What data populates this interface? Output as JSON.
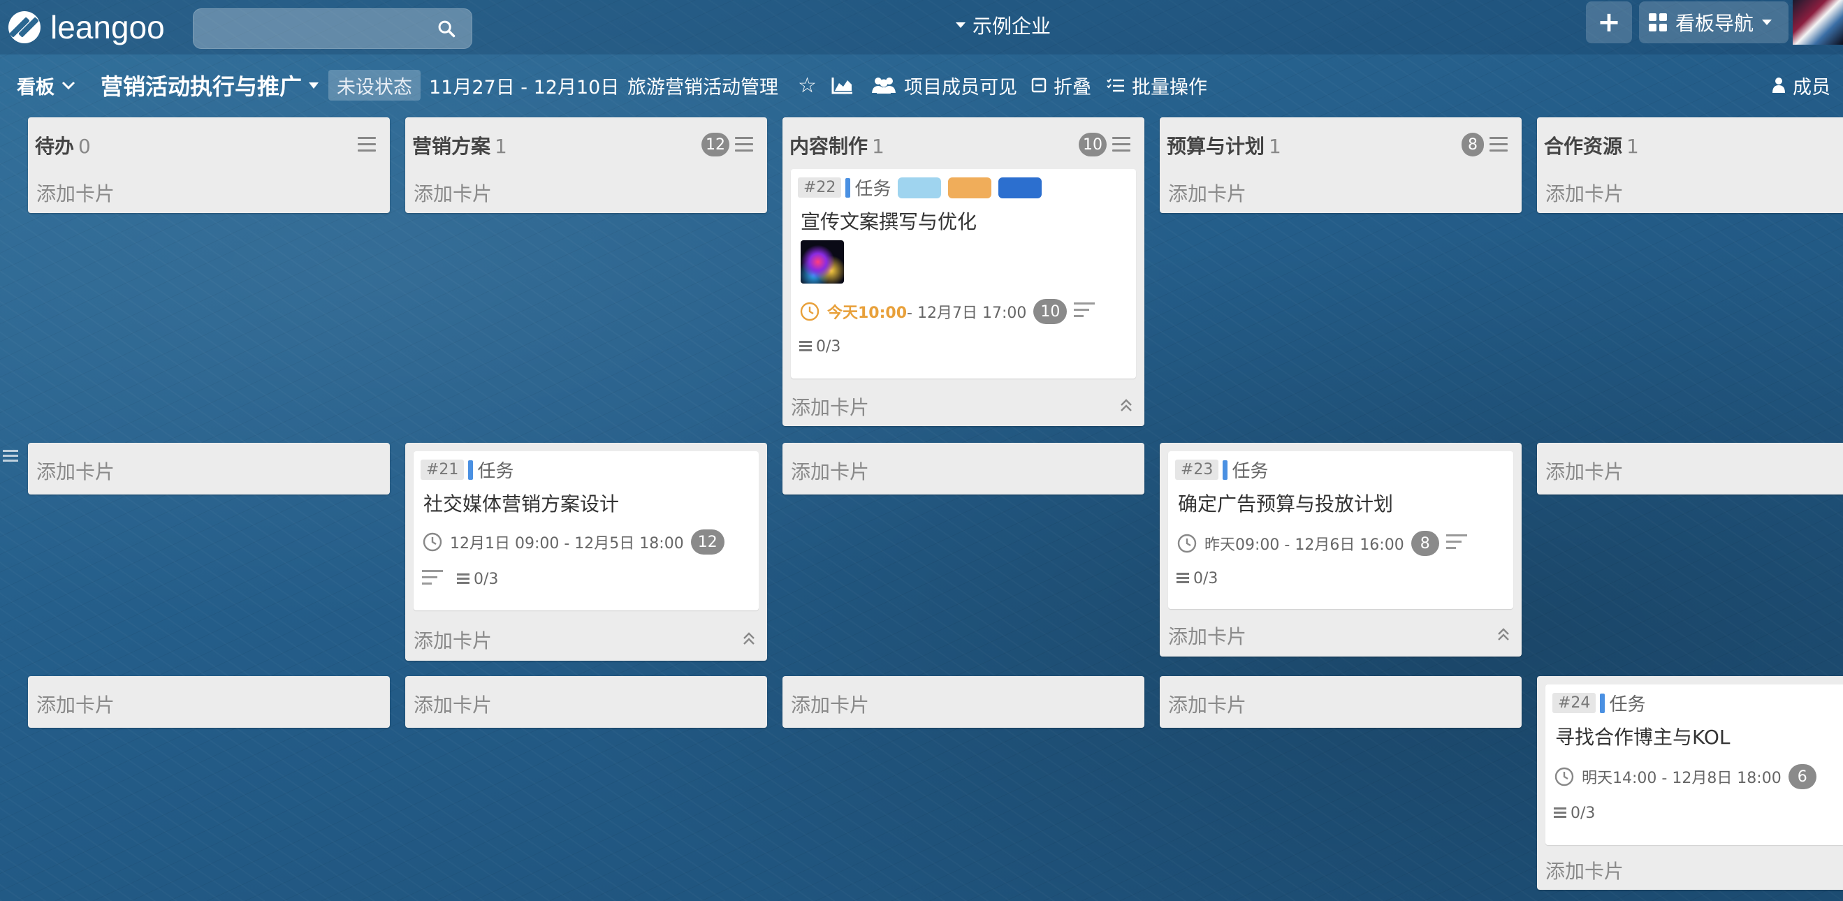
{
  "app": {
    "logo_text": "leangoo",
    "org_name": "示例企业",
    "nav_button_label": "看板导航",
    "plus_label": "+"
  },
  "boardbar": {
    "board_menu": "看板",
    "board_title": "营销活动执行与推广",
    "status": "未设状态",
    "date_range": "11月27日 - 12月10日",
    "project": "旅游营销活动管理",
    "members_visibility": "项目成员可见",
    "fold": "折叠",
    "batch": "批量操作",
    "members": "成员"
  },
  "lists": [
    {
      "name": "待办",
      "count": "0",
      "wip": ""
    },
    {
      "name": "营销方案",
      "count": "1",
      "wip": "12"
    },
    {
      "name": "内容制作",
      "count": "1",
      "wip": "10"
    },
    {
      "name": "预算与计划",
      "count": "1",
      "wip": "8"
    },
    {
      "name": "合作资源",
      "count": "1",
      "wip": ""
    }
  ],
  "add_card": "添加卡片",
  "cards": {
    "c22": {
      "id": "#22",
      "type": "任务",
      "title": "宣传文案撰写与优化",
      "time_start": "今天10:00",
      "time_end": " - 12月7日 17:00",
      "points": "10",
      "checklist": "0/3",
      "tags": [
        "#9fd4ef",
        "#f0ad5a",
        "#2c6fcf"
      ]
    },
    "c21": {
      "id": "#21",
      "type": "任务",
      "title": "社交媒体营销方案设计",
      "time": "12月1日 09:00 - 12月5日 18:00",
      "points": "12",
      "checklist": "0/3"
    },
    "c23": {
      "id": "#23",
      "type": "任务",
      "title": "确定广告预算与投放计划",
      "time": "昨天09:00 - 12月6日 16:00",
      "points": "8",
      "checklist": "0/3"
    },
    "c24": {
      "id": "#24",
      "type": "任务",
      "title": "寻找合作博主与KOL",
      "time": "明天14:00 - 12月8日 18:00",
      "points": "6",
      "checklist": "0/3"
    }
  },
  "colors": {
    "accent": "#4a90e2",
    "today": "#e8a03a",
    "pill": "#8a8a8a"
  }
}
